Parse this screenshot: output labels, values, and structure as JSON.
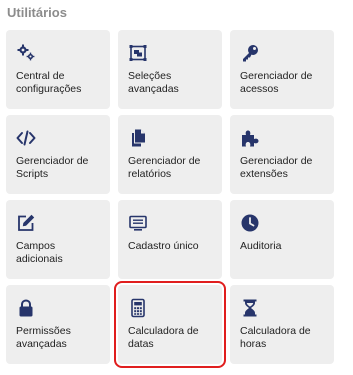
{
  "section": {
    "title": "Utilitários"
  },
  "accent_color": "#27356b",
  "selection_color": "#e01e1e",
  "tiles": [
    {
      "label": "Central de\nconfigurações",
      "icon": "gears-icon"
    },
    {
      "label": "Seleções\navançadas",
      "icon": "selection-icon"
    },
    {
      "label": "Gerenciador de\nacessos",
      "icon": "key-icon"
    },
    {
      "label": "Gerenciador de\nScripts",
      "icon": "code-icon"
    },
    {
      "label": "Gerenciador de\nrelatórios",
      "icon": "copy-icon"
    },
    {
      "label": "Gerenciador de\nextensões",
      "icon": "puzzle-icon"
    },
    {
      "label": "Campos\nadicionais",
      "icon": "edit-icon"
    },
    {
      "label": "Cadastro único",
      "icon": "list-icon"
    },
    {
      "label": "Auditoria",
      "icon": "clock-icon"
    },
    {
      "label": "Permissões\navançadas",
      "icon": "lock-icon"
    },
    {
      "label": "Calculadora de\ndatas",
      "icon": "calculator-icon",
      "selected": true
    },
    {
      "label": "Calculadora de\nhoras",
      "icon": "hourglass-icon"
    }
  ]
}
